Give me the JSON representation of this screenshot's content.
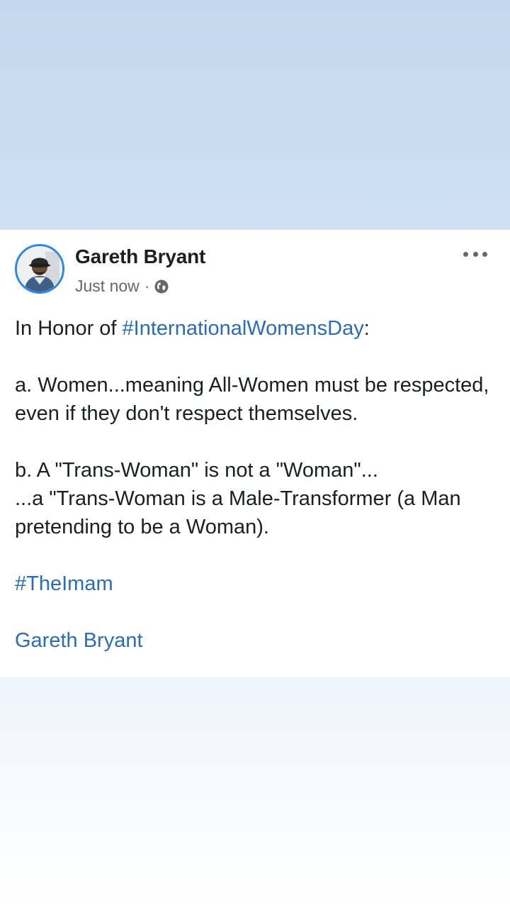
{
  "post": {
    "author": "Gareth Bryant",
    "timestamp": "Just now",
    "separator": "·",
    "privacy_icon": "globe-icon",
    "more_icon": "more-options-icon",
    "intro_prefix": "In Honor of ",
    "intro_hashtag": "#InternationalWomensDay",
    "intro_suffix": ":",
    "point_a": "a. Women...meaning All-Women must be respected, even if they don't respect themselves.",
    "point_b_line1": "b. A \"Trans-Woman\" is not a \"Woman\"...",
    "point_b_line2": "...a \"Trans-Woman is a Male-Transformer (a Man pretending to be a Woman).",
    "hashtag": "#TheImam",
    "author_tag": "Gareth Bryant"
  },
  "colors": {
    "link": "#2a6db5",
    "avatar_ring": "#2d88e0",
    "background_top": "#c3d7ee",
    "text": "#1c1e21",
    "muted": "#65676b"
  }
}
